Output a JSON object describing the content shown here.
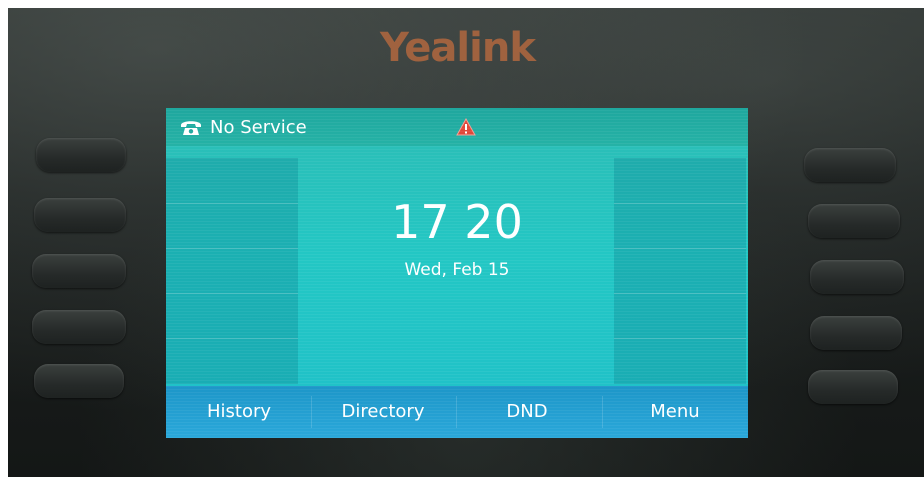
{
  "device": {
    "brand": "Yealink"
  },
  "status_bar": {
    "label": "No Service",
    "icon": "telephone-icon",
    "alert_icon": "warning-icon",
    "alert_color": "#e0483a"
  },
  "home": {
    "time": "17 20",
    "date": "Wed, Feb 15"
  },
  "softkeys": [
    {
      "label": "History"
    },
    {
      "label": "Directory"
    },
    {
      "label": "DND"
    },
    {
      "label": "Menu"
    }
  ],
  "colors": {
    "screen": "#23c7c4",
    "status_bar": "#1fa79e",
    "softkey_bar": "#1d96c8",
    "brand": "#b1683f"
  }
}
